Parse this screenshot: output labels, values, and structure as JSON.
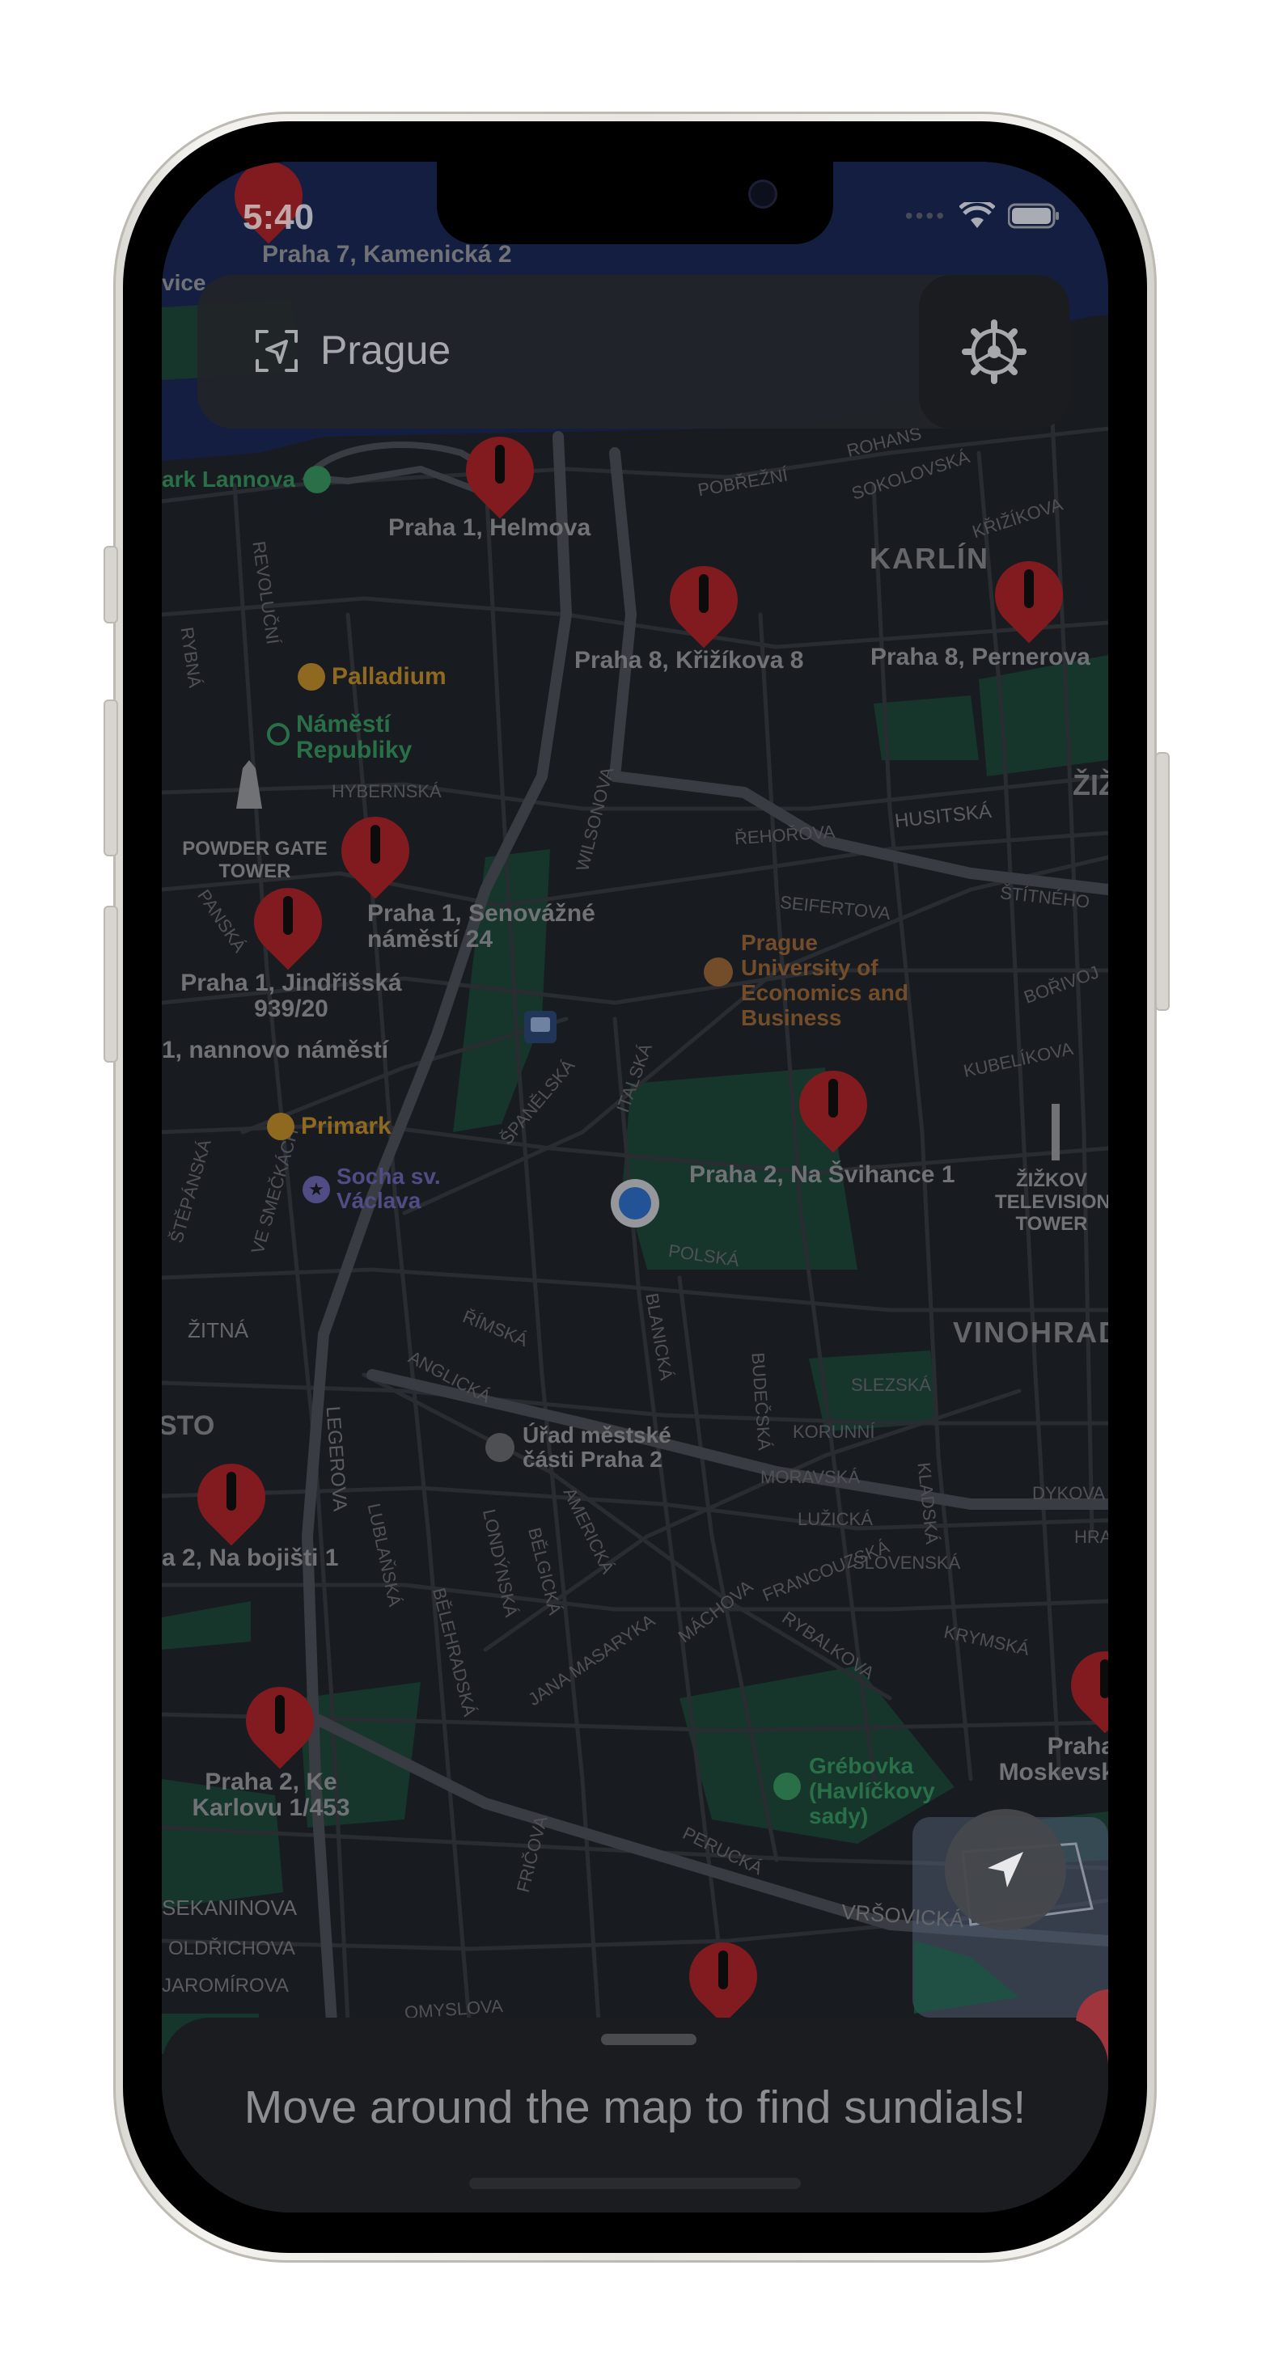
{
  "status_bar": {
    "time": "5:40"
  },
  "search": {
    "placeholder": "Prague",
    "icon": "location-search-icon"
  },
  "settings": {
    "icon": "gear-icon"
  },
  "map": {
    "district_labels": [
      "KARLÍN",
      "VINOHRADY",
      "ŽIŽ"
    ],
    "street_labels": [
      "ROHANS",
      "POBŘEŽNÍ",
      "SOKOLOVSKÁ",
      "KŘIŽÍKOVA",
      "REVOLUČNÍ",
      "RYBNÁ",
      "HYBERNSKÁ",
      "WILSONOVA",
      "HUSITSKÁ",
      "ŘEHOŘOVA",
      "SEIFERTOVA",
      "ŠTÍTNÉHO",
      "BOŘIVOJ",
      "KUBELÍKOVA",
      "PANSKÁ",
      "ŠPANĚLSKÁ",
      "ITALSKÁ",
      "POLSKÁ",
      "ŽITNÁ",
      "ŘÍMSKÁ",
      "ANGLICKÁ",
      "BLANICKÁ",
      "BUDEČSKÁ",
      "SLEZSKÁ",
      "KORUNNÍ",
      "MORAVSKÁ",
      "LUŽICKÁ",
      "SLOVENSKÁ",
      "KRYMSKÁ",
      "FRANCOUZSKÁ",
      "RYBALKOVA",
      "MÁCHOVA",
      "JANA MASARYKA",
      "BĚLEHRADSKÁ",
      "LONDÝNSKÁ",
      "BĚLGICKÁ",
      "AMERICKÁ",
      "LUBLAŇSKÁ",
      "LEGEROVA",
      "KLADSKÁ",
      "DYKOVA",
      "HRA",
      "VE SMEČKÁCH",
      "ŠTĚPÁNSKÁ",
      "PERUCKÁ",
      "FRIČOVA",
      "VRŠOVICKÁ",
      "SEKANINOVA",
      "OLDŘICHOVA",
      "JAROMÍROVA",
      "OMYSLOVA",
      "STO"
    ],
    "pois": [
      {
        "name": "Palladium",
        "color": "#c8922e"
      },
      {
        "name": "Náměstí Republiky",
        "color": "#3a9a63"
      },
      {
        "name": "POWDER GATE TOWER",
        "color": "#9c9ea3"
      },
      {
        "name": "Prague University of Economics and Business",
        "color": "#a06b3b"
      },
      {
        "name": "Primark",
        "color": "#c8922e"
      },
      {
        "name": "Socha sv. Václava",
        "color": "#6f6ab8"
      },
      {
        "name": "ŽIŽKOV TELEVISION TOWER",
        "color": "#9c9ea3"
      },
      {
        "name": "Úřad městské části Praha 2",
        "color": "#9c9ea3"
      },
      {
        "name": "Grébovka (Havlíčkovy sady)",
        "color": "#3a9a63"
      },
      {
        "name": "ark Lannova",
        "color": "#3a9a63"
      },
      {
        "name": "vice",
        "color": "#9c9ea3"
      }
    ],
    "sundials": [
      "Praha 7, Kamenická 2",
      "Praha 1, Helmova",
      "Praha 8, Křižíkova 8",
      "Praha 8, Pernerova",
      "Praha 1, Senovážné náměstí 24",
      "Praha 1, Jindřišská 939/20",
      "1, nannovo náměstí",
      "Praha 2, Na Švihance 1",
      "a 2, Na bojišti 1",
      "Praha 2, Ke Karlovu 1/453",
      "Praha Moskevsk"
    ]
  },
  "bottom_sheet": {
    "message": "Move around the map to find sundials!"
  },
  "colors": {
    "pin": "#b3262b",
    "map_bg": "#22262c",
    "park": "#1f4a3c",
    "user_dot": "#2f74d0"
  }
}
